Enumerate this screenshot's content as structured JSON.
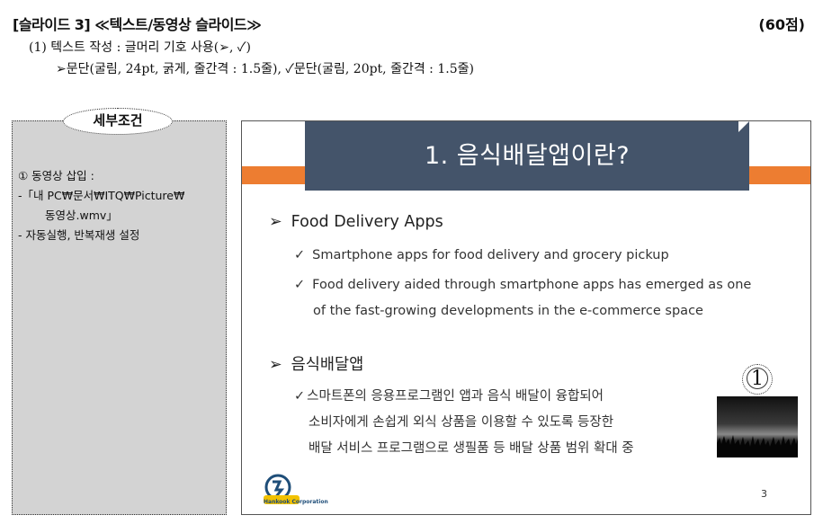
{
  "header": {
    "title": "[슬라이드 3] ≪텍스트/동영상 슬라이드≫",
    "score": "(60점)",
    "req_line1": "(1) 텍스트 작성 : 글머리 기호 사용(➢, ✓)",
    "req_line2": "➢문단(굴림, 24pt, 굵게, 줄간격 : 1.5줄), ✓문단(굴림, 20pt, 줄간격 : 1.5줄)"
  },
  "conditions": {
    "tag": "세부조건",
    "item1": "① 동영상 삽입 :",
    "item2a": "-「내 PC₩문서₩ITQ₩Picture₩",
    "item2b": "동영상.wmv」",
    "item3": "- 자동실행, 반복재생 설정"
  },
  "slide": {
    "title": "1. 음식배달앱이란?",
    "section1": {
      "heading": "Food Delivery Apps",
      "bullet1": "Smartphone apps for food delivery and grocery pickup",
      "bullet2_line1": "Food delivery aided through smartphone apps has emerged as one",
      "bullet2_line2": "of the fast-growing developments in the e-commerce space"
    },
    "section2": {
      "heading": "음식배달앱",
      "line1": "스마트폰의 응용프로그램인 앱과 음식 배달이 융합되어",
      "line2": "소비자에게 손쉽게 외식 상품을 이용할 수 있도록 등장한",
      "line3": "배달 서비스 프로그램으로 생필품 등 배달 상품 범위 확대 중"
    },
    "marker": "1",
    "bullet_arrow": "➢",
    "bullet_check": "✓",
    "logo_text": "Hankook Corporation",
    "page_number": "3"
  },
  "colors": {
    "title_box": "#44546a",
    "accent_bar": "#ed7d31",
    "panel": "#d3d3d3"
  }
}
